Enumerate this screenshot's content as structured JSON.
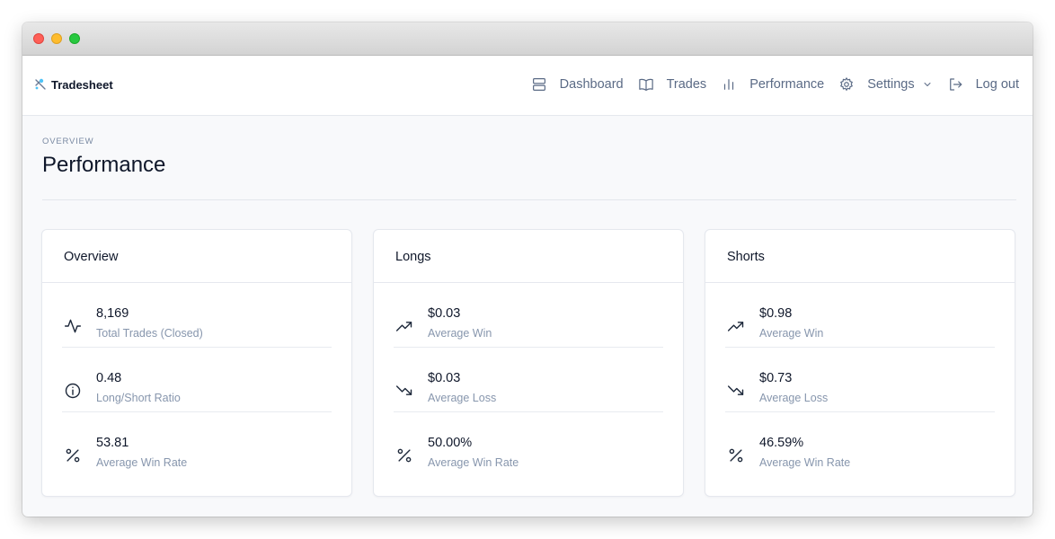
{
  "app": {
    "name": "Tradesheet"
  },
  "nav": {
    "items": [
      {
        "label": "Dashboard",
        "icon": "server-stack-icon"
      },
      {
        "label": "Trades",
        "icon": "book-open-icon"
      },
      {
        "label": "Performance",
        "icon": "bar-chart-icon"
      },
      {
        "label": "Settings",
        "icon": "gear-icon"
      },
      {
        "label": "Log out",
        "icon": "logout-icon"
      }
    ]
  },
  "page": {
    "eyebrow": "OVERVIEW",
    "title": "Performance"
  },
  "cards": {
    "overview": {
      "title": "Overview",
      "stats": [
        {
          "value": "8,169",
          "label": "Total Trades (Closed)",
          "icon": "activity-icon"
        },
        {
          "value": "0.48",
          "label": "Long/Short Ratio",
          "icon": "info-circle-icon"
        },
        {
          "value": "53.81",
          "label": "Average Win Rate",
          "icon": "percent-icon"
        }
      ]
    },
    "longs": {
      "title": "Longs",
      "stats": [
        {
          "value": "$0.03",
          "label": "Average Win",
          "icon": "trending-up-icon"
        },
        {
          "value": "$0.03",
          "label": "Average Loss",
          "icon": "trending-down-icon"
        },
        {
          "value": "50.00%",
          "label": "Average Win Rate",
          "icon": "percent-icon"
        }
      ]
    },
    "shorts": {
      "title": "Shorts",
      "stats": [
        {
          "value": "$0.98",
          "label": "Average Win",
          "icon": "trending-up-icon"
        },
        {
          "value": "$0.73",
          "label": "Average Loss",
          "icon": "trending-down-icon"
        },
        {
          "value": "46.59%",
          "label": "Average Win Rate",
          "icon": "percent-icon"
        }
      ]
    }
  }
}
